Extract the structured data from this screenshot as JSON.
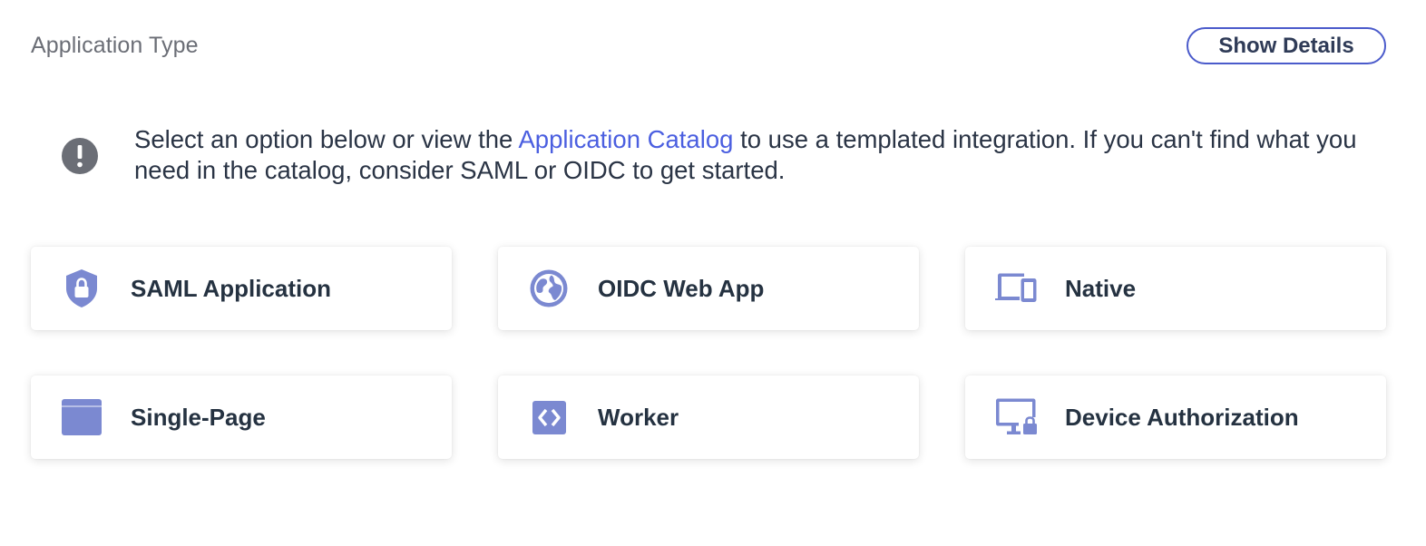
{
  "header": {
    "title": "Application Type",
    "show_details_label": "Show Details"
  },
  "notice": {
    "icon": "exclamation-circle-icon",
    "text_before": "Select an option below or view the ",
    "link_text": "Application Catalog",
    "text_after": " to use a templated integration. If you can't find what you need in the catalog, consider SAML or OIDC to get started."
  },
  "accent_color": "#7b89d1",
  "options": [
    {
      "label": "SAML Application",
      "icon": "shield-lock-icon"
    },
    {
      "label": "OIDC Web App",
      "icon": "globe-icon"
    },
    {
      "label": "Native",
      "icon": "laptop-phone-icon"
    },
    {
      "label": "Single-Page",
      "icon": "browser-window-icon"
    },
    {
      "label": "Worker",
      "icon": "code-icon"
    },
    {
      "label": "Device Authorization",
      "icon": "monitor-lock-icon"
    }
  ]
}
